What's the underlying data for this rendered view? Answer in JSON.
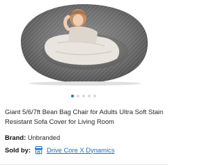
{
  "product": {
    "image_alt": "Giant bean bag chair",
    "title": "Giant 5/6/7ft Bean Bag Chair for Adults Ultra Soft Stain Resistant Sofa Cover for Living Room",
    "brand_label": "Brand:",
    "brand_value": "Unbranded",
    "seller_label": "Sold by:",
    "seller_name": "Drive Core X Dynamics"
  },
  "carousel": {
    "total_dots": 5,
    "active_index": 0
  },
  "colors": {
    "accent": "#1a7ab9",
    "link": "#1a6fc4",
    "fur": "#6e6e6e"
  },
  "icons": {
    "seller": "store-icon"
  }
}
